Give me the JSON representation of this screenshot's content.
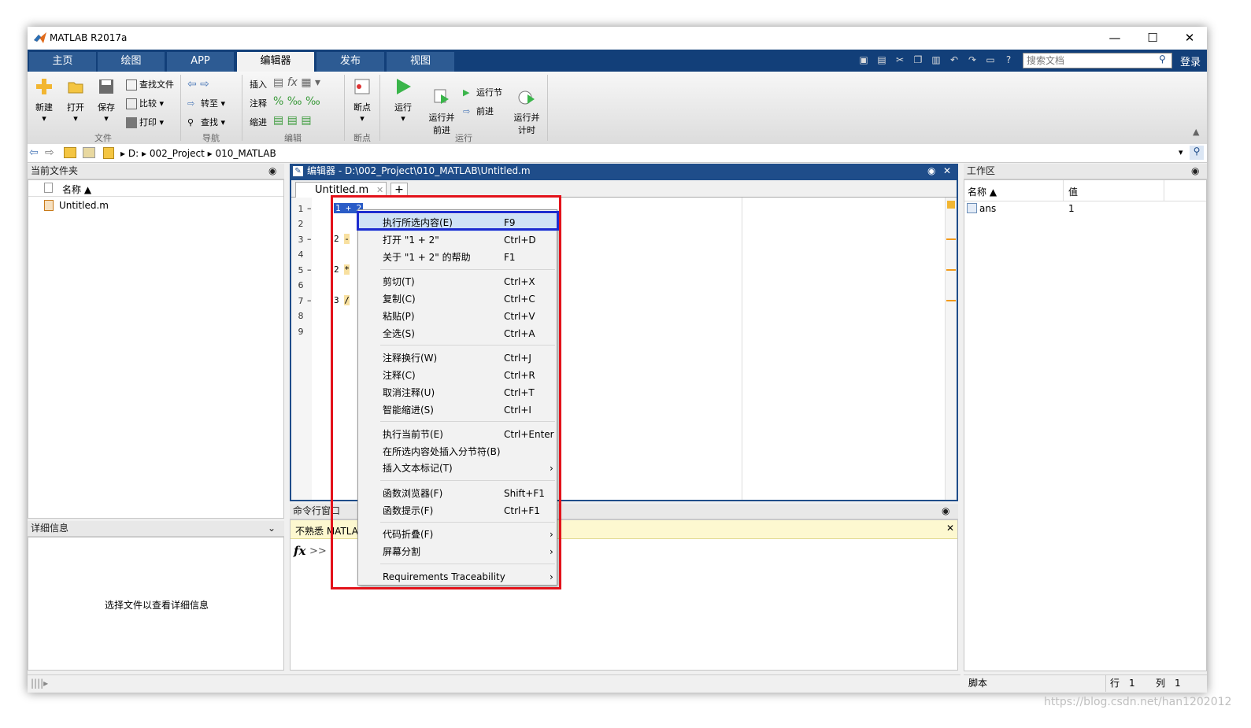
{
  "window": {
    "title": "MATLAB R2017a"
  },
  "tabs": [
    {
      "label": "主页"
    },
    {
      "label": "绘图"
    },
    {
      "label": "APP"
    },
    {
      "label": "编辑器"
    },
    {
      "label": "发布"
    },
    {
      "label": "视图"
    }
  ],
  "search": {
    "placeholder": "搜索文档"
  },
  "login": "登录",
  "ribbon": {
    "file": {
      "new": "新建",
      "open": "打开",
      "save": "保存",
      "find_files": "查找文件",
      "compare": "比较",
      "print": "打印",
      "group": "文件"
    },
    "nav": {
      "goto": "转至",
      "find": "查找",
      "group": "导航"
    },
    "edit": {
      "insert": "插入",
      "comment": "注释",
      "indent": "缩进",
      "group": "编辑"
    },
    "breakpoints": {
      "label": "断点",
      "group": "断点"
    },
    "run": {
      "run": "运行",
      "run_advance": "运行并\n前进",
      "run_section": "运行节",
      "advance": "前进",
      "run_time": "运行并\n计时",
      "group": "运行"
    }
  },
  "address": {
    "drive": "D:",
    "folder1": "002_Project",
    "folder2": "010_MATLAB"
  },
  "current_folder": {
    "title": "当前文件夹",
    "col_name": "名称 ▲",
    "files": [
      "Untitled.m"
    ]
  },
  "details": {
    "title": "详细信息",
    "placeholder": "选择文件以查看详细信息"
  },
  "editor": {
    "title": "编辑器 - D:\\002_Project\\010_MATLAB\\Untitled.m",
    "tab": "Untitled.m",
    "plus": "+",
    "lines": [
      "1",
      "2",
      "3",
      "4",
      "5",
      "6",
      "7",
      "8",
      "9"
    ],
    "code": [
      {
        "num": "1",
        "text": "1 + 2"
      },
      {
        "num": "3",
        "text": "2 -"
      },
      {
        "num": "5",
        "text": "2 *"
      },
      {
        "num": "7",
        "text": "3 /"
      }
    ]
  },
  "command_window": {
    "title": "命令行窗口",
    "notice": "不熟悉 MATLA",
    "prompt": ">>"
  },
  "workspace": {
    "title": "工作区",
    "col_name": "名称 ▲",
    "col_value": "值",
    "rows": [
      {
        "name": "ans",
        "value": "1"
      }
    ]
  },
  "context_menu": [
    {
      "label": "执行所选内容(E)",
      "shortcut": "F9"
    },
    {
      "label": "打开 \"1 + 2\"",
      "shortcut": "Ctrl+D"
    },
    {
      "label": "关于 \"1 + 2\" 的帮助",
      "shortcut": "F1"
    },
    {
      "label": "剪切(T)",
      "shortcut": "Ctrl+X"
    },
    {
      "label": "复制(C)",
      "shortcut": "Ctrl+C"
    },
    {
      "label": "粘贴(P)",
      "shortcut": "Ctrl+V"
    },
    {
      "label": "全选(S)",
      "shortcut": "Ctrl+A"
    },
    {
      "label": "注释换行(W)",
      "shortcut": "Ctrl+J"
    },
    {
      "label": "注释(C)",
      "shortcut": "Ctrl+R"
    },
    {
      "label": "取消注释(U)",
      "shortcut": "Ctrl+T"
    },
    {
      "label": "智能缩进(S)",
      "shortcut": "Ctrl+I"
    },
    {
      "label": "执行当前节(E)",
      "shortcut": "Ctrl+Enter"
    },
    {
      "label": "在所选内容处插入分节符(B)",
      "shortcut": ""
    },
    {
      "label": "插入文本标记(T)",
      "shortcut": "›"
    },
    {
      "label": "函数浏览器(F)",
      "shortcut": "Shift+F1"
    },
    {
      "label": "函数提示(F)",
      "shortcut": "Ctrl+F1"
    },
    {
      "label": "代码折叠(F)",
      "shortcut": "›"
    },
    {
      "label": "屏幕分割",
      "shortcut": "›"
    },
    {
      "label": "Requirements Traceability",
      "shortcut": "›"
    }
  ],
  "status": {
    "type": "脚本",
    "row_label": "行",
    "row": "1",
    "col_label": "列",
    "col": "1"
  },
  "watermark": "https://blog.csdn.net/han1202012",
  "colors": {
    "tab_bar": "#123f79",
    "editor_accent": "#1f4d8a",
    "red_box": "#e3121a",
    "blue_box": "#1d2ccf"
  }
}
